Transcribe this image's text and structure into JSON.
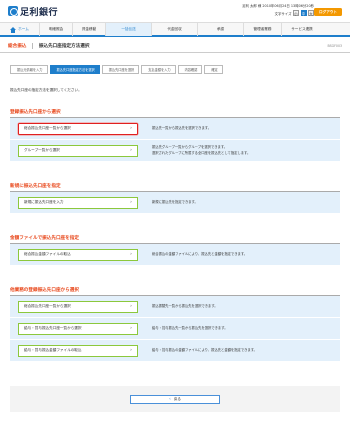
{
  "header": {
    "bank_name": "足利銀行",
    "user_line": "足利 太郎 様 2010年06月24日 13時06分20秒",
    "font_size_label": "文字サイズ",
    "font_sizes": [
      "小",
      "中",
      "大"
    ],
    "logout_label": "ログアウト"
  },
  "gnav": {
    "items": [
      "ホーム",
      "明細照会",
      "資金移動",
      "一括伝送",
      "代金回収",
      "承認",
      "管理者業務",
      "サービス連携"
    ]
  },
  "page": {
    "category": "総合振込",
    "title": "振込先口座指定方法選択",
    "code": "BSGF003"
  },
  "steps": [
    "振込元情報を入力",
    "振込先口座指定方法を選択",
    "振込先口座を選択",
    "支払金額を入力",
    "内容確認",
    "確定"
  ],
  "description": "振込先口座の指定方法を選択してください。",
  "sections": [
    {
      "heading": "登録振込先口座から選択",
      "rows": [
        {
          "button": "総合振込先口座一覧から選択",
          "text": [
            "振込先一覧から振込先を選択できます。"
          ]
        },
        {
          "button": "グループ一覧から選択",
          "text": [
            "振込先グループ一覧からグループを選択できます。",
            "選択されたグループに所属する全口座を振込先として指定します。"
          ]
        }
      ]
    },
    {
      "heading": "新規に振込先口座を指定",
      "rows": [
        {
          "button": "新規に振込先口座を入力",
          "text": [
            "新規に振込先を指定できます。"
          ]
        }
      ]
    },
    {
      "heading": "金額ファイルで振込先口座を指定",
      "rows": [
        {
          "button": "総合振込金額ファイルの取込",
          "text": [
            "総合振込の金額ファイルにより、振込先と金額を指定できます。"
          ]
        }
      ]
    },
    {
      "heading": "他業務の登録振込先口座から選択",
      "rows": [
        {
          "button": "総合振込先口座一覧から選択",
          "text": [
            "振込振替先一覧から振込先を選択できます。"
          ]
        },
        {
          "button": "給与・賞与振込先口座一覧から選択",
          "text": [
            "給与・賞与振込先一覧から振込先を選択できます。"
          ]
        },
        {
          "button": "給与・賞与振込金額ファイルの取込",
          "text": [
            "給与・賞与振込の金額ファイルにより、振込先と金額を指定できます。"
          ]
        }
      ]
    }
  ],
  "back_label": "戻る",
  "colors": {
    "accent": "#1e7ecb",
    "heading": "#e8491d",
    "selected_border": "#e02020",
    "button_border": "#8cc83c"
  }
}
